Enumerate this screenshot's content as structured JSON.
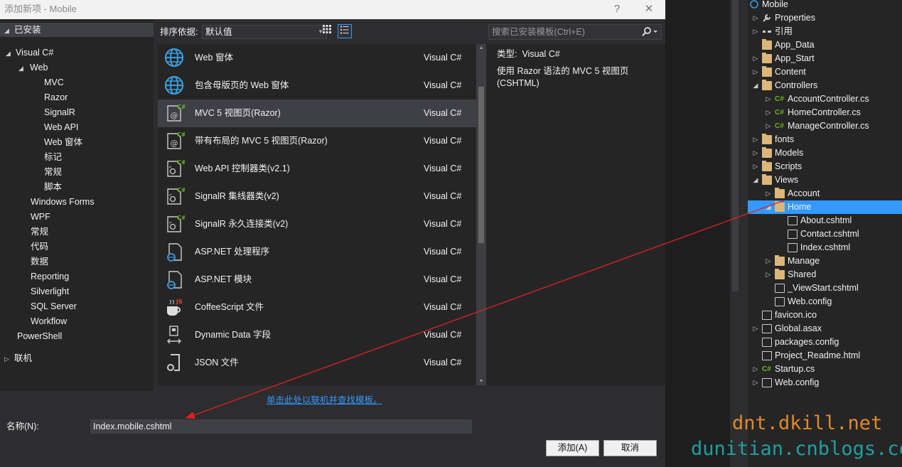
{
  "dialog": {
    "title": "添加新项 - Mobile",
    "help_glyph": "?",
    "close_glyph": "✕",
    "installed_header": "已安装",
    "tree": {
      "visual_csharp": "Visual C#",
      "web": "Web",
      "web_children": [
        "MVC",
        "Razor",
        "SignalR",
        "Web API",
        "Web 窗体",
        "标记",
        "常规",
        "脚本"
      ],
      "csharp_children": [
        "Windows Forms",
        "WPF",
        "常规",
        "代码",
        "数据",
        "Reporting",
        "Silverlight",
        "SQL Server",
        "Workflow"
      ],
      "powershell": "PowerShell",
      "online": "联机"
    },
    "sort_label": "排序依据:",
    "sort_value": "默认值",
    "search_placeholder": "搜索已安装模板(Ctrl+E)",
    "templates": [
      {
        "name": "Web 窗体",
        "lang": "Visual C#",
        "icon": "globe-icon"
      },
      {
        "name": "包含母版页的 Web 窗体",
        "lang": "Visual C#",
        "icon": "globe-icon"
      },
      {
        "name": "MVC 5 视图页(Razor)",
        "lang": "Visual C#",
        "icon": "razor-page-icon"
      },
      {
        "name": "带有布局的 MVC 5 视图页(Razor)",
        "lang": "Visual C#",
        "icon": "razor-page-icon"
      },
      {
        "name": "Web API 控制器类(v2.1)",
        "lang": "Visual C#",
        "icon": "class-icon"
      },
      {
        "name": "SignalR 集线器类(v2)",
        "lang": "Visual C#",
        "icon": "class-icon"
      },
      {
        "name": "SignalR 永久连接类(v2)",
        "lang": "Visual C#",
        "icon": "class-icon"
      },
      {
        "name": "ASP.NET 处理程序",
        "lang": "Visual C#",
        "icon": "handler-icon"
      },
      {
        "name": "ASP.NET 模块",
        "lang": "Visual C#",
        "icon": "module-icon"
      },
      {
        "name": "CoffeeScript 文件",
        "lang": "Visual C#",
        "icon": "coffee-icon"
      },
      {
        "name": "Dynamic Data 字段",
        "lang": "Visual C#",
        "icon": "dynamic-data-icon"
      },
      {
        "name": "JSON 文件",
        "lang": "Visual C#",
        "icon": "json-icon"
      }
    ],
    "selected_index": 2,
    "details": {
      "type_label": "类型:",
      "type_value": "Visual C#",
      "description": "使用 Razor 语法的 MVC 5 视图页(CSHTML)"
    },
    "online_link": "单击此处以联机并查找模板。",
    "name_label": "名称(N):",
    "name_value": "Index.mobile.cshtml",
    "add_button": "添加(A)",
    "cancel_button": "取消"
  },
  "solution_explorer": {
    "items": [
      {
        "label": "Mobile",
        "indent": 0,
        "icon": "project-icon",
        "caret": ""
      },
      {
        "label": "Properties",
        "indent": 1,
        "icon": "wrench-icon",
        "caret": "▷"
      },
      {
        "label": "引用",
        "indent": 1,
        "icon": "references-icon",
        "caret": "▷"
      },
      {
        "label": "App_Data",
        "indent": 1,
        "icon": "folder-icon",
        "caret": ""
      },
      {
        "label": "App_Start",
        "indent": 1,
        "icon": "folder-icon",
        "caret": "▷"
      },
      {
        "label": "Content",
        "indent": 1,
        "icon": "folder-icon",
        "caret": "▷"
      },
      {
        "label": "Controllers",
        "indent": 1,
        "icon": "open-folder-icon",
        "caret": "◢"
      },
      {
        "label": "AccountController.cs",
        "indent": 2,
        "icon": "csharp-icon",
        "caret": "▷"
      },
      {
        "label": "HomeController.cs",
        "indent": 2,
        "icon": "csharp-icon",
        "caret": "▷"
      },
      {
        "label": "ManageController.cs",
        "indent": 2,
        "icon": "csharp-icon",
        "caret": "▷"
      },
      {
        "label": "fonts",
        "indent": 1,
        "icon": "folder-icon",
        "caret": "▷"
      },
      {
        "label": "Models",
        "indent": 1,
        "icon": "folder-icon",
        "caret": "▷"
      },
      {
        "label": "Scripts",
        "indent": 1,
        "icon": "folder-icon",
        "caret": "▷"
      },
      {
        "label": "Views",
        "indent": 1,
        "icon": "open-folder-icon",
        "caret": "◢"
      },
      {
        "label": "Account",
        "indent": 2,
        "icon": "folder-icon",
        "caret": "▷"
      },
      {
        "label": "Home",
        "indent": 2,
        "icon": "open-folder-icon",
        "caret": "◢",
        "selected": true
      },
      {
        "label": "About.cshtml",
        "indent": 3,
        "icon": "cshtml-icon",
        "caret": ""
      },
      {
        "label": "Contact.cshtml",
        "indent": 3,
        "icon": "cshtml-icon",
        "caret": ""
      },
      {
        "label": "Index.cshtml",
        "indent": 3,
        "icon": "cshtml-icon",
        "caret": ""
      },
      {
        "label": "Manage",
        "indent": 2,
        "icon": "folder-icon",
        "caret": "▷"
      },
      {
        "label": "Shared",
        "indent": 2,
        "icon": "folder-icon",
        "caret": "▷"
      },
      {
        "label": "_ViewStart.cshtml",
        "indent": 2,
        "icon": "cshtml-icon",
        "caret": ""
      },
      {
        "label": "Web.config",
        "indent": 2,
        "icon": "config-icon",
        "caret": ""
      },
      {
        "label": "favicon.ico",
        "indent": 1,
        "icon": "image-file-icon",
        "caret": ""
      },
      {
        "label": "Global.asax",
        "indent": 1,
        "icon": "config-icon",
        "caret": "▷"
      },
      {
        "label": "packages.config",
        "indent": 1,
        "icon": "config-icon",
        "caret": ""
      },
      {
        "label": "Project_Readme.html",
        "indent": 1,
        "icon": "html-file-icon",
        "caret": ""
      },
      {
        "label": "Startup.cs",
        "indent": 1,
        "icon": "csharp-icon",
        "caret": "▷"
      },
      {
        "label": "Web.config",
        "indent": 1,
        "icon": "config-icon",
        "caret": "▷"
      }
    ]
  },
  "watermark": {
    "line1": "dnt.dkill.net",
    "line2": "dunitian.cnblogs.com"
  },
  "colors": {
    "accent": "#3399ff",
    "annotation_arrow": "#e02020",
    "watermark1": "#e0892a",
    "watermark2": "#1fa0a0"
  }
}
